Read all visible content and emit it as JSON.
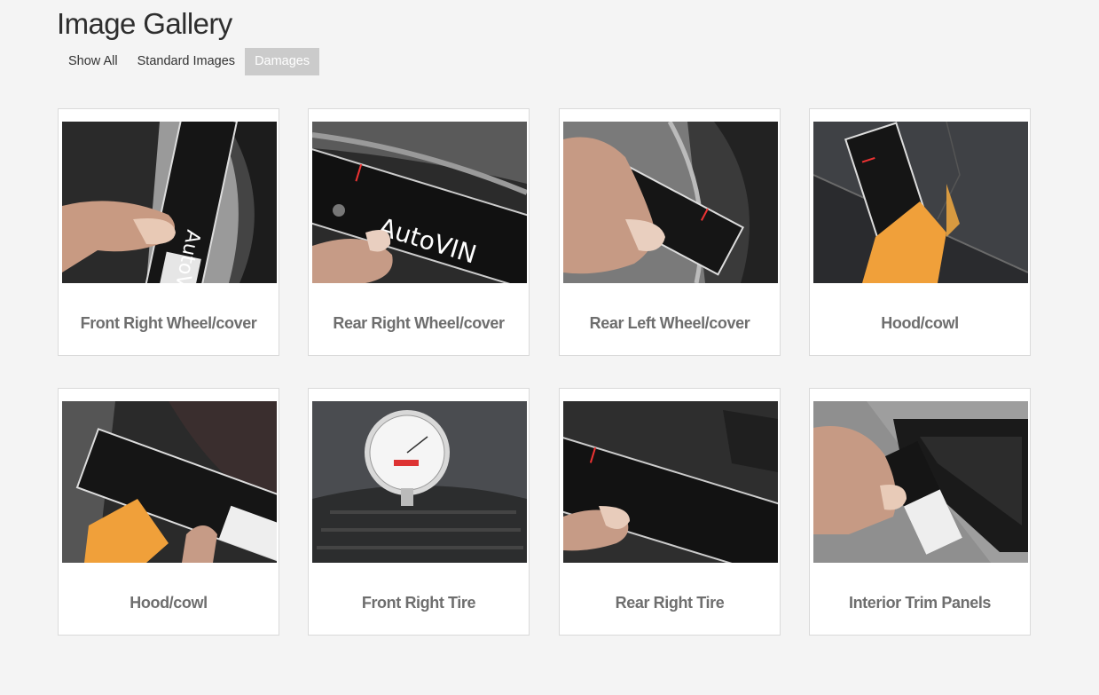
{
  "header": {
    "title": "Image Gallery"
  },
  "filters": [
    {
      "label": "Show All",
      "active": false
    },
    {
      "label": "Standard Images",
      "active": false
    },
    {
      "label": "Damages",
      "active": true
    }
  ],
  "ruler_brand": "AutoVIN",
  "gallery": [
    {
      "caption": "Front Right Wheel/cover"
    },
    {
      "caption": "Rear Right Wheel/cover"
    },
    {
      "caption": "Rear Left Wheel/cover"
    },
    {
      "caption": "Hood/cowl"
    },
    {
      "caption": "Hood/cowl"
    },
    {
      "caption": "Front Right Tire"
    },
    {
      "caption": "Rear Right Tire"
    },
    {
      "caption": "Interior Trim Panels"
    }
  ]
}
